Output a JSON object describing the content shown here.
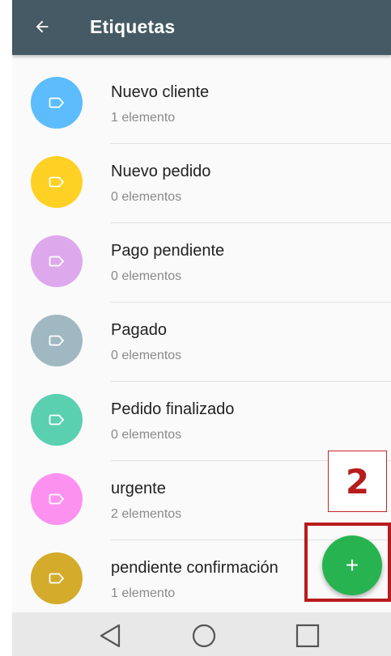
{
  "app_bar": {
    "title": "Etiquetas",
    "back_icon": "arrow-left-icon",
    "background": "#455a64"
  },
  "labels": [
    {
      "name": "Nuevo cliente",
      "count": "1 elemento",
      "color": "#5cbcfc",
      "icon": "tag-icon"
    },
    {
      "name": "Nuevo pedido",
      "count": "0 elementos",
      "color": "#ffd124",
      "icon": "tag-icon"
    },
    {
      "name": "Pago pendiente",
      "count": "0 elementos",
      "color": "#dea9ec",
      "icon": "tag-icon"
    },
    {
      "name": "Pagado",
      "count": "0 elementos",
      "color": "#9fb8c2",
      "icon": "tag-icon"
    },
    {
      "name": "Pedido finalizado",
      "count": "0 elementos",
      "color": "#5ad0b1",
      "icon": "tag-icon"
    },
    {
      "name": "urgente",
      "count": "2 elementos",
      "color": "#fd91f0",
      "icon": "tag-icon"
    },
    {
      "name": "pendiente confirmación",
      "count": "1 elemento",
      "color": "#d4ab2a",
      "icon": "tag-icon"
    }
  ],
  "fab": {
    "label": "+",
    "icon": "plus-icon",
    "color": "#28b351"
  },
  "nav_bar": {
    "buttons": [
      "back-triangle-icon",
      "home-circle-icon",
      "recents-square-icon"
    ]
  },
  "annotation": {
    "number": "2",
    "color": "#b71c1c"
  }
}
